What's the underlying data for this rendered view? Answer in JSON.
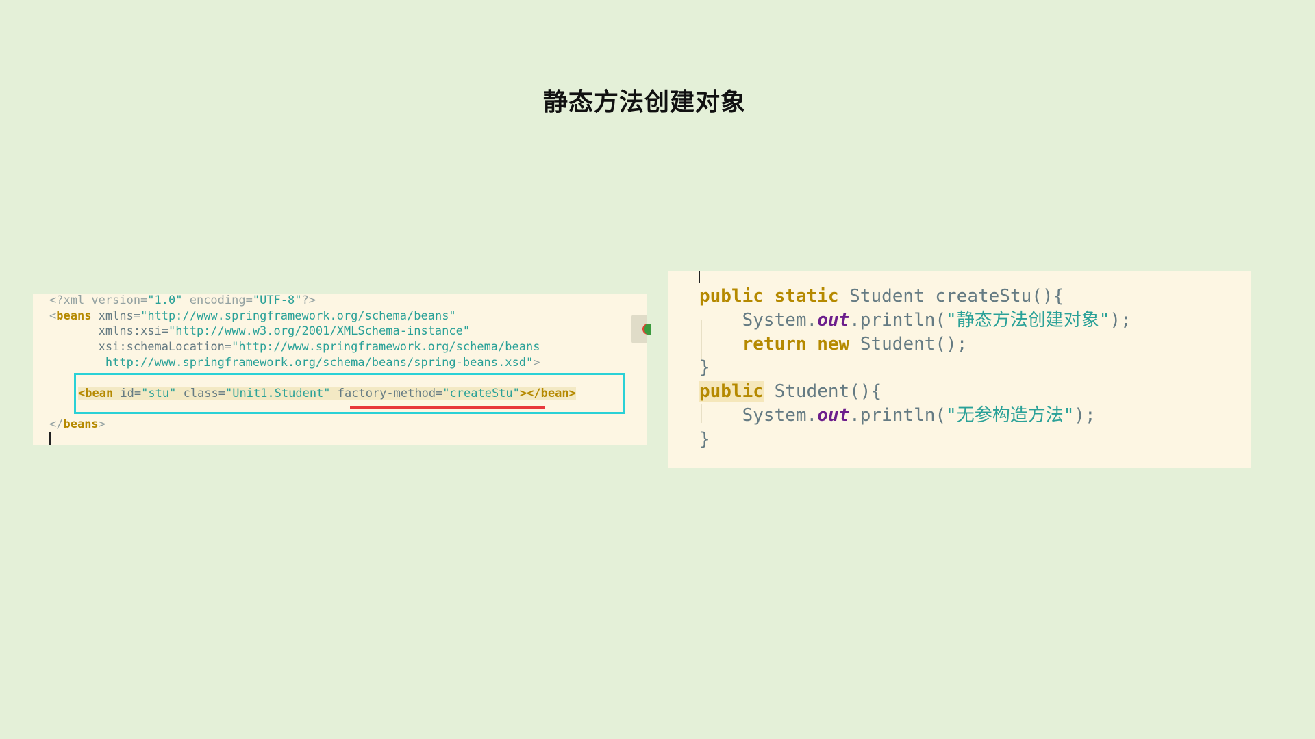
{
  "title": "静态方法创建对象",
  "xml_code": {
    "line1": {
      "p1": "<?xml version=",
      "v1": "\"1.0\"",
      "p2": " encoding=",
      "v2": "\"UTF-8\"",
      "p3": "?>"
    },
    "line2": {
      "lt": "<",
      "tag": "beans",
      "attr": " xmlns=",
      "val": "\"http://www.springframework.org/schema/beans\""
    },
    "line3": {
      "attr": "       xmlns:xsi=",
      "val": "\"http://www.w3.org/2001/XMLSchema-instance\""
    },
    "line4": {
      "attr": "       xsi:schemaLocation=",
      "val": "\"http://www.springframework.org/schema/beans"
    },
    "line5": {
      "val": "        http://www.springframework.org/schema/beans/spring-beans.xsd\"",
      "gt": ">"
    },
    "line6": {
      "lt": "<",
      "tag": "bean",
      "a1": " id=",
      "v1": "\"stu\"",
      "a2": " class=",
      "v2": "\"Unit1.Student\"",
      "a3": " factory-method=",
      "v3": "\"createStu\"",
      "gt": ">",
      "close_lt": "</",
      "close_tag": "bean",
      "close_gt": ">"
    },
    "line7": {
      "lt": "</",
      "tag": "beans",
      "gt": ">"
    }
  },
  "java_code": {
    "line1": {
      "k1": "public",
      "k2": "static",
      "rest": " Student createStu(){"
    },
    "line2": {
      "pre": "    System.",
      "field": "out",
      "mid": ".println(",
      "str": "\"静态方法创建对象\"",
      "end": ");"
    },
    "line3": {
      "pre": "    ",
      "k1": "return",
      "k2": "new",
      "rest": " Student();"
    },
    "line4": {
      "text": "}"
    },
    "line5": {
      "k1": "public",
      "rest": " Student(){"
    },
    "line6": {
      "pre": "    System.",
      "field": "out",
      "mid": ".println(",
      "str": "\"无参构造方法\"",
      "end": ");"
    },
    "line7": {
      "text": "}"
    }
  }
}
